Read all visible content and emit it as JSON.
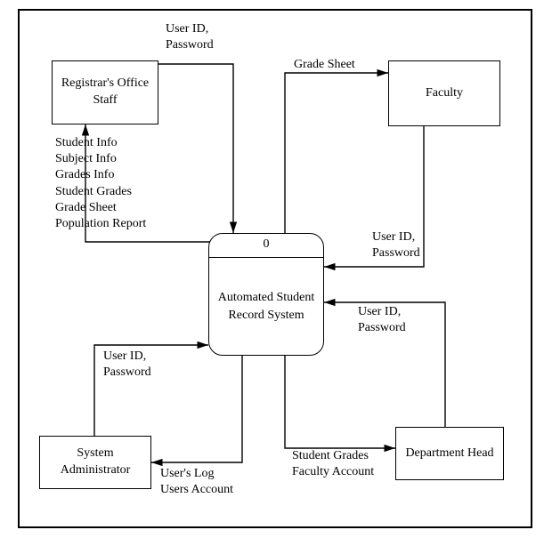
{
  "process": {
    "number": "0",
    "title": "Automated\nStudent\nRecord\nSystem"
  },
  "entities": {
    "registrar": "Registrar's\nOffice Staff",
    "faculty": "Faculty",
    "sysadmin": "System\nAdministrator",
    "depthead": "Department\nHead"
  },
  "flows": {
    "registrar_in": "User ID,\nPassword",
    "registrar_out": "Student Info\nSubject Info\nGrades Info\nStudent Grades\nGrade Sheet\nPopulation Report",
    "faculty_in": "User ID,\nPassword",
    "faculty_out": "Grade Sheet",
    "sysadmin_in": "User ID,\nPassword",
    "sysadmin_out": "User's Log\nUsers Account",
    "depthead_in": "User ID,\nPassword",
    "depthead_out": "Student Grades\nFaculty Account"
  }
}
